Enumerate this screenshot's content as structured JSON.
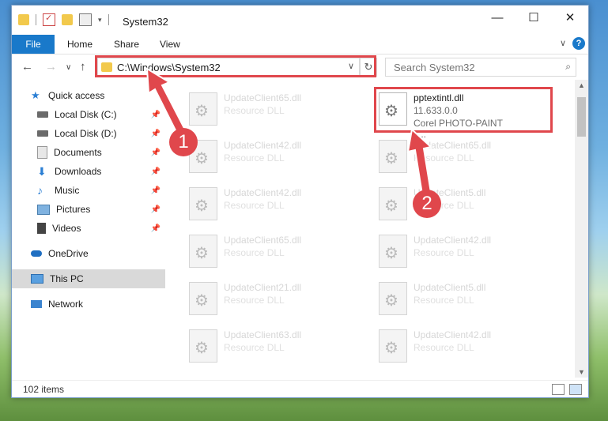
{
  "window": {
    "title": "System32",
    "controls": {
      "minimize": "—",
      "maximize": "☐",
      "close": "✕"
    }
  },
  "ribbon": {
    "file": "File",
    "tabs": [
      "Home",
      "Share",
      "View"
    ],
    "help": "?"
  },
  "nav": {
    "back": "←",
    "forward": "→",
    "recent": "∨",
    "up": "↑",
    "address": "C:\\Windows\\System32",
    "refresh": "↻",
    "search_placeholder": "Search System32"
  },
  "sidebar": {
    "items": [
      {
        "label": "Quick access",
        "icon": "star-icon",
        "pinned": false
      },
      {
        "label": "Local Disk (C:)",
        "icon": "drive-icon",
        "pinned": true
      },
      {
        "label": "Local Disk (D:)",
        "icon": "drive-icon",
        "pinned": true
      },
      {
        "label": "Documents",
        "icon": "documents-icon",
        "pinned": true
      },
      {
        "label": "Downloads",
        "icon": "download-icon",
        "pinned": true
      },
      {
        "label": "Music",
        "icon": "music-icon",
        "pinned": true
      },
      {
        "label": "Pictures",
        "icon": "pictures-icon",
        "pinned": true
      },
      {
        "label": "Videos",
        "icon": "videos-icon",
        "pinned": true
      },
      {
        "label": "OneDrive",
        "icon": "cloud-icon",
        "pinned": false
      },
      {
        "label": "This PC",
        "icon": "computer-icon",
        "pinned": false,
        "selected": true
      },
      {
        "label": "Network",
        "icon": "network-icon",
        "pinned": false
      }
    ]
  },
  "files": {
    "highlighted": {
      "name": "pptextintl.dll",
      "version": "11.633.0.0",
      "description": "Corel PHOTO-PAINT T..."
    },
    "left_column": [
      {
        "name": "UpdateClient65.dll",
        "type": "Resource DLL"
      },
      {
        "name": "UpdateClient42.dll",
        "type": "Resource DLL"
      },
      {
        "name": "UpdateClient42.dll",
        "type": "Resource DLL"
      },
      {
        "name": "UpdateClient65.dll",
        "type": "Resource DLL"
      },
      {
        "name": "UpdateClient21.dll",
        "type": "Resource DLL"
      },
      {
        "name": "UpdateClient63.dll",
        "type": "Resource DLL"
      }
    ],
    "right_column": [
      {
        "name": "UpdateClient65.dll",
        "type": "Resource DLL"
      },
      {
        "name": "UpdateClient5.dll",
        "type": "Resource DLL"
      },
      {
        "name": "UpdateClient42.dll",
        "type": "Resource DLL"
      },
      {
        "name": "UpdateClient5.dll",
        "type": "Resource DLL"
      },
      {
        "name": "UpdateClient42.dll",
        "type": "Resource DLL"
      }
    ]
  },
  "status": {
    "count": "102 items"
  },
  "annotations": {
    "step1": "1",
    "step2": "2",
    "color": "#e0474c"
  }
}
